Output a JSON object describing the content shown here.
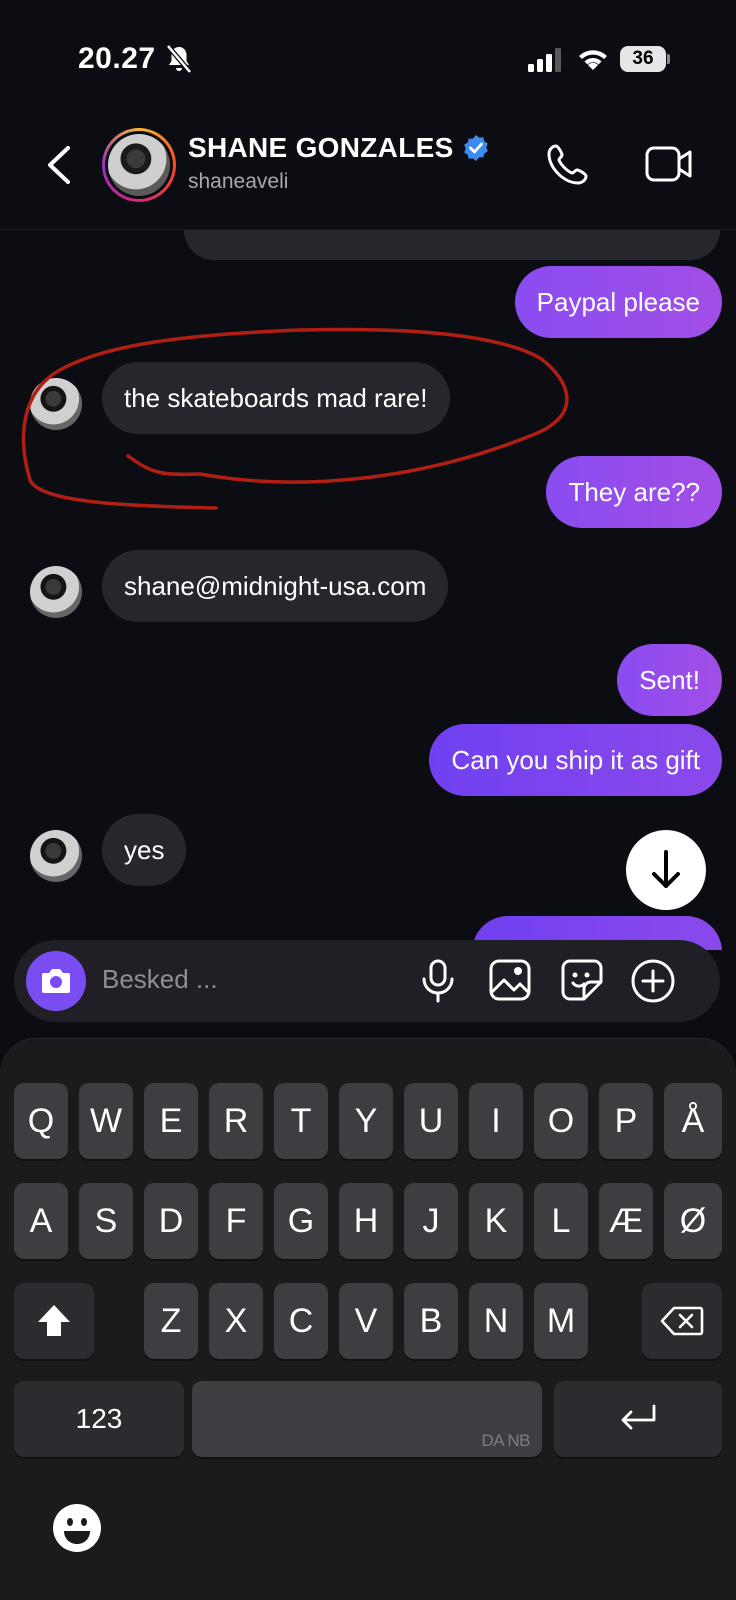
{
  "status_bar": {
    "time": "20.27",
    "battery": "36"
  },
  "header": {
    "name": "SHANE GONZALES",
    "handle": "shaneaveli"
  },
  "messages": [
    {
      "side": "out",
      "text": "Paypal please"
    },
    {
      "side": "in",
      "text": "the skateboards mad rare!"
    },
    {
      "side": "out",
      "text": "They are??"
    },
    {
      "side": "in",
      "text": "shane@midnight-usa.com"
    },
    {
      "side": "out",
      "text": "Sent!"
    },
    {
      "side": "out",
      "text": "Can you ship it as gift"
    },
    {
      "side": "in",
      "text": "yes"
    }
  ],
  "composer": {
    "placeholder": "Besked ..."
  },
  "keyboard": {
    "row1": [
      "Q",
      "W",
      "E",
      "R",
      "T",
      "Y",
      "U",
      "I",
      "O",
      "P",
      "Å"
    ],
    "row2": [
      "A",
      "S",
      "D",
      "F",
      "G",
      "H",
      "J",
      "K",
      "L",
      "Æ",
      "Ø"
    ],
    "row3": [
      "Z",
      "X",
      "C",
      "V",
      "B",
      "N",
      "M"
    ],
    "numbers_key": "123",
    "language_hint": "DA NB"
  },
  "colors": {
    "accent": "#7a4df3",
    "annotation": "#b01e14"
  }
}
